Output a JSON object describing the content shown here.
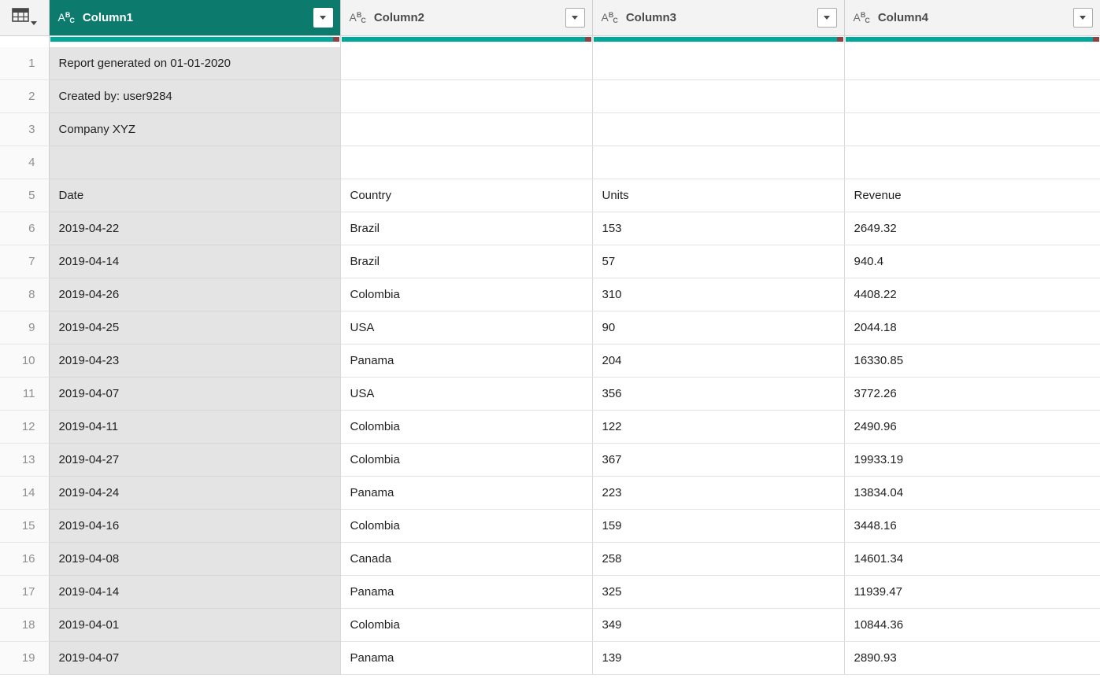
{
  "app": "Power Query Editor data preview",
  "grid": {
    "corner": {
      "icon": "table-select-all-icon"
    },
    "columns": [
      {
        "label": "Column1",
        "type": "ABC",
        "selected": true
      },
      {
        "label": "Column2",
        "type": "ABC",
        "selected": false
      },
      {
        "label": "Column3",
        "type": "ABC",
        "selected": false
      },
      {
        "label": "Column4",
        "type": "ABC",
        "selected": false
      }
    ],
    "rows": [
      {
        "num": "1",
        "cells": [
          "Report generated on 01-01-2020",
          "",
          "",
          ""
        ]
      },
      {
        "num": "2",
        "cells": [
          "Created by: user9284",
          "",
          "",
          ""
        ]
      },
      {
        "num": "3",
        "cells": [
          "Company XYZ",
          "",
          "",
          ""
        ]
      },
      {
        "num": "4",
        "cells": [
          "",
          "",
          "",
          ""
        ]
      },
      {
        "num": "5",
        "cells": [
          "Date",
          "Country",
          "Units",
          "Revenue"
        ]
      },
      {
        "num": "6",
        "cells": [
          "2019-04-22",
          "Brazil",
          "153",
          "2649.32"
        ]
      },
      {
        "num": "7",
        "cells": [
          "2019-04-14",
          "Brazil",
          "57",
          "940.4"
        ]
      },
      {
        "num": "8",
        "cells": [
          "2019-04-26",
          "Colombia",
          "310",
          "4408.22"
        ]
      },
      {
        "num": "9",
        "cells": [
          "2019-04-25",
          "USA",
          "90",
          "2044.18"
        ]
      },
      {
        "num": "10",
        "cells": [
          "2019-04-23",
          "Panama",
          "204",
          "16330.85"
        ]
      },
      {
        "num": "11",
        "cells": [
          "2019-04-07",
          "USA",
          "356",
          "3772.26"
        ]
      },
      {
        "num": "12",
        "cells": [
          "2019-04-11",
          "Colombia",
          "122",
          "2490.96"
        ]
      },
      {
        "num": "13",
        "cells": [
          "2019-04-27",
          "Colombia",
          "367",
          "19933.19"
        ]
      },
      {
        "num": "14",
        "cells": [
          "2019-04-24",
          "Panama",
          "223",
          "13834.04"
        ]
      },
      {
        "num": "15",
        "cells": [
          "2019-04-16",
          "Colombia",
          "159",
          "3448.16"
        ]
      },
      {
        "num": "16",
        "cells": [
          "2019-04-08",
          "Canada",
          "258",
          "14601.34"
        ]
      },
      {
        "num": "17",
        "cells": [
          "2019-04-14",
          "Panama",
          "325",
          "11939.47"
        ]
      },
      {
        "num": "18",
        "cells": [
          "2019-04-01",
          "Colombia",
          "349",
          "10844.36"
        ]
      },
      {
        "num": "19",
        "cells": [
          "2019-04-07",
          "Panama",
          "139",
          "2890.93"
        ]
      }
    ],
    "colors": {
      "selected_header_bg": "#0c7a6c",
      "header_bg": "#f3f3f3",
      "quality_bar": "#00a89b",
      "quality_error": "#8e4342",
      "selected_column_cell_bg": "#e4e4e4",
      "grid_line": "#d9d9d9",
      "cell_text": "#1f1f1f",
      "row_number_text": "#909090"
    }
  }
}
